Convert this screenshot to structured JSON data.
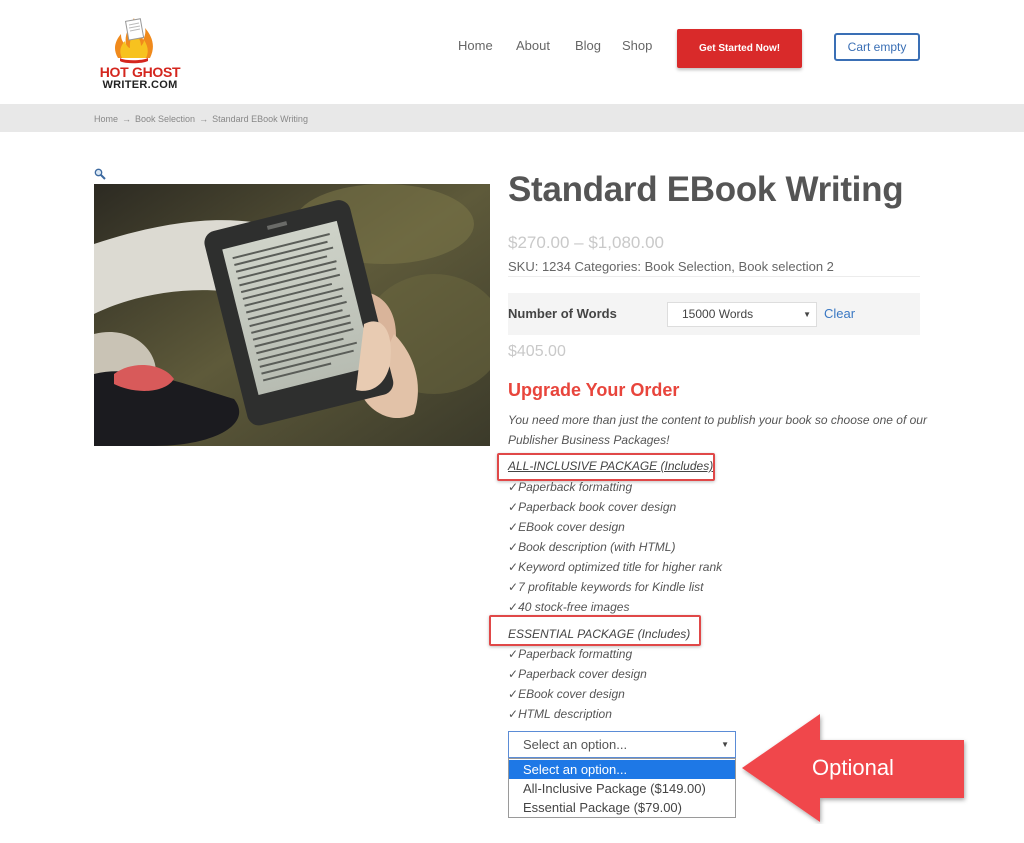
{
  "brand": {
    "line1": "HOT GHOST",
    "line2": "WRITER.COM"
  },
  "nav": {
    "items": [
      "Home",
      "About",
      "Blog",
      "Shop"
    ],
    "cta_label": "Get Started Now!",
    "cart_label": "Cart empty"
  },
  "breadcrumb": {
    "items": [
      "Home",
      "Book Selection",
      "Standard EBook Writing"
    ],
    "separator": "→"
  },
  "product": {
    "title": "Standard EBook Writing",
    "price_range": "$270.00 – $1,080.00",
    "meta": "SKU: 1234 Categories: Book Selection, Book selection 2",
    "variation_label": "Number of Words",
    "variation_value": "15000 Words",
    "clear_label": "Clear",
    "selected_price": "$405.00"
  },
  "upgrade": {
    "heading": "Upgrade Your Order",
    "intro": "You need more than just the content to publish your book so choose one of our Publisher Business Packages!",
    "check_mark": "✓",
    "packages": [
      {
        "heading": "ALL-INCLUSIVE PACKAGE (Includes)",
        "items": [
          "Paperback formatting",
          "Paperback book cover design",
          "EBook cover design",
          "Book description (with HTML)",
          "Keyword optimized title for higher rank",
          "7 profitable keywords for Kindle list",
          "40 stock-free images"
        ]
      },
      {
        "heading": "ESSENTIAL PACKAGE (Includes)",
        "items": [
          "Paperback formatting",
          "Paperback cover design",
          "EBook cover design",
          "HTML description"
        ]
      }
    ],
    "select_value": "Select an option...",
    "options": [
      "Select an option...",
      "All-Inclusive Package ($149.00)",
      "Essential Package ($79.00)"
    ]
  },
  "callout": {
    "label": "Optional"
  },
  "colors": {
    "accent_red": "#d92a2a",
    "link_blue": "#3a78c3",
    "heading_red": "#e8453c",
    "highlight_blue": "#1e78e6"
  }
}
